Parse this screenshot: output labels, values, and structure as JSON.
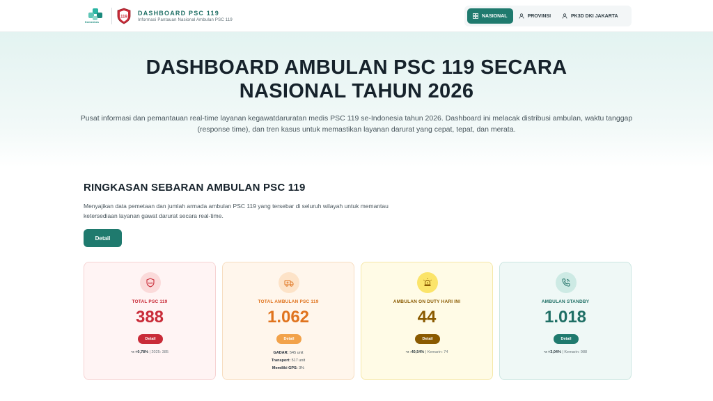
{
  "header": {
    "brand_small": "Kemenkes",
    "badge_text": "119",
    "title": "DASHBOARD PSC 119",
    "subtitle": "Informasi Pantauan Nasional Ambulan PSC 119",
    "nav": [
      {
        "label": "NASIONAL",
        "icon": "grid-icon",
        "active": true
      },
      {
        "label": "PROVINSI",
        "icon": "user-icon",
        "active": false
      },
      {
        "label": "PK3D DKI JAKARTA",
        "icon": "user-icon",
        "active": false
      }
    ]
  },
  "hero": {
    "title_line1": "DASHBOARD AMBULAN PSC 119 SECARA",
    "title_line2": "NASIONAL TAHUN 2026",
    "description": "Pusat informasi dan pemantauan real-time layanan kegawatdaruratan medis PSC 119 se-Indonesia tahun 2026. Dashboard ini melacak distribusi ambulan, waktu tanggap (response time), dan tren kasus untuk memastikan layanan darurat yang cepat, tepat, dan merata."
  },
  "section": {
    "title": "RINGKASAN SEBARAN AMBULAN PSC 119",
    "description": "Menyajikan data pemetaan dan jumlah armada ambulan PSC 119 yang tersebar di seluruh wilayah untuk memantau ketersediaan layanan gawat darurat secara real-time.",
    "button": "Detail"
  },
  "cards": [
    {
      "label": "TOTAL PSC 119",
      "value": "388",
      "button": "Detail",
      "icon": "psc-shield-icon",
      "trend": "↝ +0,78%",
      "trend_note": "| 2025: 385",
      "color": "#c92b38"
    },
    {
      "label": "TOTAL AMBULAN PSC 119",
      "value": "1.062",
      "button": "Detail",
      "icon": "ambulance-icon",
      "details": [
        {
          "k": "GADAR:",
          "v": "545 unit"
        },
        {
          "k": "Transport:",
          "v": "517 unit"
        },
        {
          "k": "Memiliki GPS:",
          "v": "3%"
        }
      ],
      "color": "#e0741f"
    },
    {
      "label": "AMBULAN ON DUTY HARI INI",
      "value": "44",
      "button": "Detail",
      "icon": "siren-icon",
      "trend": "↝ -40,54%",
      "trend_note": "| Kemarin: 74",
      "color": "#8a5a00"
    },
    {
      "label": "AMBULAN STANDBY",
      "value": "1.018",
      "button": "Detail",
      "icon": "phone-call-icon",
      "trend": "↝ +3,04%",
      "trend_note": "| Kemarin: 988",
      "color": "#1f6f65"
    }
  ]
}
